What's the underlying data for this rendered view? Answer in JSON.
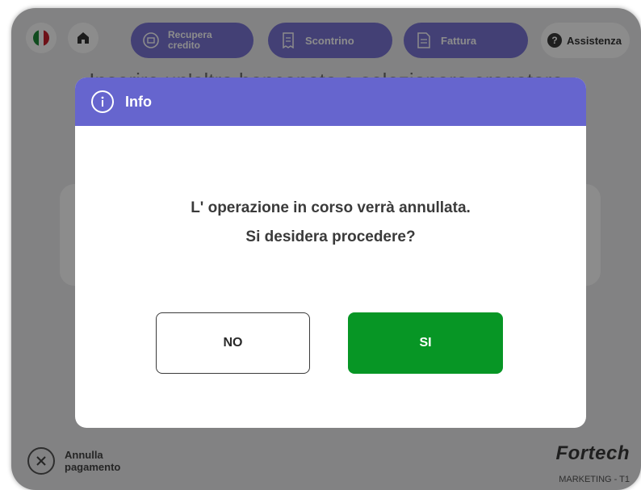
{
  "colors": {
    "accent": "#6665ce",
    "confirm": "#079625",
    "toolbar_pill": "#7b75d6",
    "overlay": "rgba(0,0,0,0.45)"
  },
  "toolbar": {
    "language_icon": "italy-flag-icon",
    "home_icon": "home-icon",
    "recover_credit_label_line1": "Recupera",
    "recover_credit_label_line2": "credito",
    "receipt_label": "Scontrino",
    "invoice_label": "Fattura",
    "help_label": "Assistenza"
  },
  "background": {
    "title": "Inserire un'altra banconota o selezionare erogatore"
  },
  "footer": {
    "cancel_line1": "Annulla",
    "cancel_line2": "pagamento",
    "brand": "Fortech",
    "terminal": "MARKETING - T1"
  },
  "dialog": {
    "title": "Info",
    "message_line1": "L' operazione in corso verrà annullata.",
    "message_line2": "Si desidera procedere?",
    "no_label": "NO",
    "yes_label": "SI"
  }
}
